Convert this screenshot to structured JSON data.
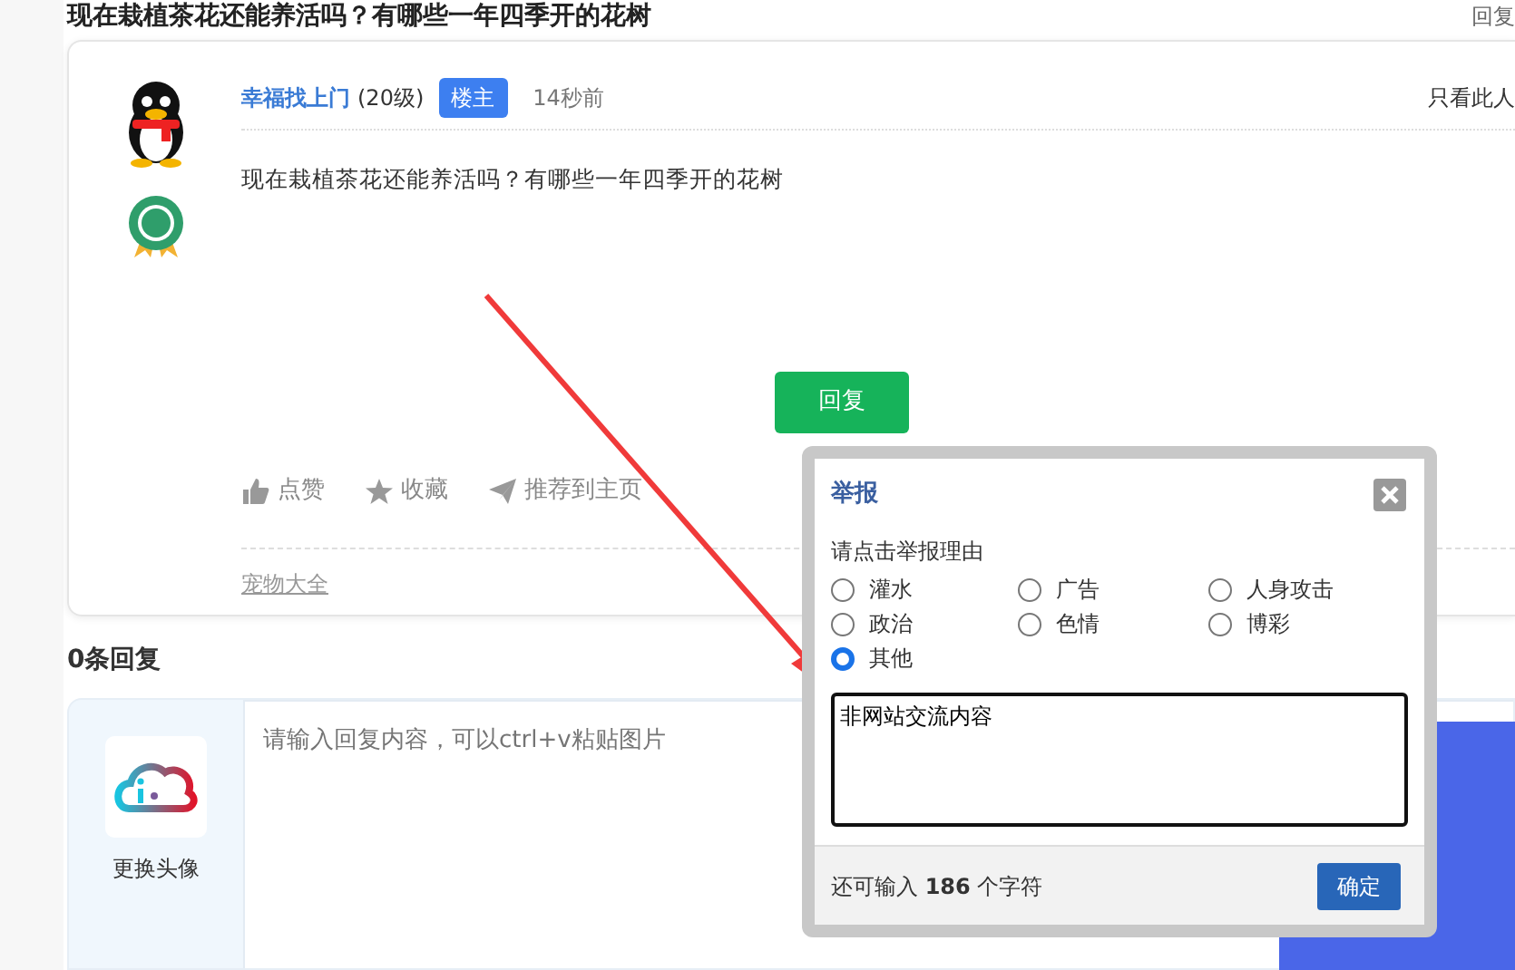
{
  "page_title": "现在栽植茶花还能养活吗？有哪些一年四季开的花树",
  "header_link": "回复",
  "post": {
    "author": "幸福找上门",
    "level": "(20级)",
    "badge": "楼主",
    "time": "14秒前",
    "only_this": "只看此人",
    "content": "现在栽植茶花还能养活吗？有哪些一年四季开的花树",
    "reply_button": "回复",
    "actions": [
      {
        "label": "点赞",
        "kind": "like"
      },
      {
        "label": "收藏",
        "kind": "star"
      },
      {
        "label": "推荐到主页",
        "kind": "send"
      }
    ],
    "tag": "宠物大全"
  },
  "replies_count": "0条回复",
  "reply_box": {
    "change_avatar": "更换头像",
    "placeholder": "请输入回复内容，可以ctrl+v粘贴图片"
  },
  "report_dialog": {
    "title": "举报",
    "prompt": "请点击举报理由",
    "reasons": [
      {
        "label": "灌水",
        "selected": false
      },
      {
        "label": "广告",
        "selected": false
      },
      {
        "label": "人身攻击",
        "selected": false
      },
      {
        "label": "政治",
        "selected": false
      },
      {
        "label": "色情",
        "selected": false
      },
      {
        "label": "博彩",
        "selected": false
      },
      {
        "label": "其他",
        "selected": true
      }
    ],
    "reason_text": "非网站交流内容",
    "remaining": "还可输入 **186** 个字符",
    "confirm": "确定"
  }
}
